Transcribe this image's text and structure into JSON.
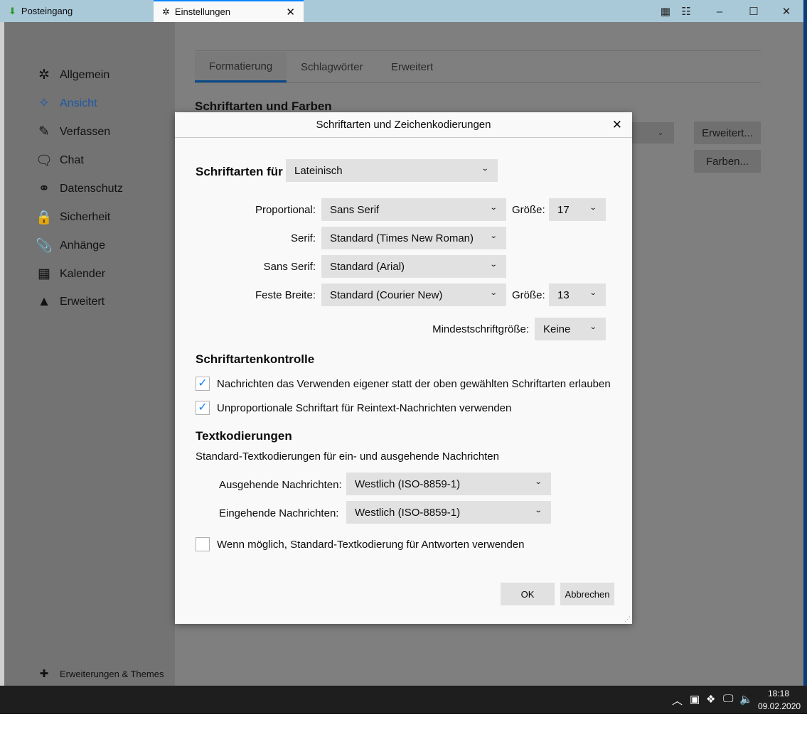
{
  "window": {
    "tabs": [
      {
        "label": "Posteingang",
        "icon": "inbox-download-icon"
      },
      {
        "label": "Einstellungen",
        "icon": "gear-icon"
      }
    ],
    "close_tab": "X"
  },
  "sidebar": {
    "items": [
      {
        "label": "Allgemein",
        "icon": "gear-icon"
      },
      {
        "label": "Ansicht",
        "icon": "sparkle-icon"
      },
      {
        "label": "Verfassen",
        "icon": "pencil-icon"
      },
      {
        "label": "Chat",
        "icon": "chat-bubble-icon"
      },
      {
        "label": "Datenschutz",
        "icon": "mask-icon"
      },
      {
        "label": "Sicherheit",
        "icon": "lock-icon"
      },
      {
        "label": "Anhänge",
        "icon": "paperclip-icon"
      },
      {
        "label": "Kalender",
        "icon": "calendar-icon"
      },
      {
        "label": "Erweitert",
        "icon": "wizard-hat-icon"
      }
    ],
    "selected": "Ansicht",
    "footer": "Erweiterungen & Themes"
  },
  "page": {
    "tabs": [
      "Formatierung",
      "Schlagwörter",
      "Erweitert"
    ],
    "section": "Schriftarten und Farben",
    "buttons": [
      "Erweitert...",
      "Farben..."
    ]
  },
  "dialog": {
    "title": "Schriftarten und Zeichenkodierungen",
    "fonts_for_label": "Schriftarten für",
    "fonts_for_value": "Lateinisch",
    "rows": [
      {
        "label": "Proportional:",
        "value": "Sans Serif"
      },
      {
        "label": "Serif:",
        "value": "Standard (Times New Roman)"
      },
      {
        "label": "Sans Serif:",
        "value": "Standard (Arial)"
      },
      {
        "label": "Feste Breite:",
        "value": "Standard (Courier New)"
      }
    ],
    "size_label": "Größe:",
    "proportional_size": "17",
    "monospace_size": "13",
    "min_size_label": "Mindestschriftgröße:",
    "min_size_value": "Keine",
    "control_heading": "Schriftartenkontrolle",
    "checkboxes": [
      {
        "label": "Nachrichten das Verwenden eigener statt der oben gewählten Schriftarten erlauben",
        "checked": true
      },
      {
        "label": "Unproportionale Schriftart für Reintext-Nachrichten verwenden",
        "checked": true
      }
    ],
    "encoding_heading": "Textkodierungen",
    "encoding_desc": "Standard-Textkodierungen für ein- und ausgehende Nachrichten",
    "outgoing_label": "Ausgehende Nachrichten:",
    "outgoing_value": "Westlich (ISO-8859-1)",
    "incoming_label": "Eingehende Nachrichten:",
    "incoming_value": "Westlich (ISO-8859-1)",
    "reply_checkbox": {
      "label": "Wenn möglich, Standard-Textkodierung für Antworten verwenden",
      "checked": false
    },
    "ok": "OK",
    "cancel": "Abbrechen"
  },
  "taskbar": {
    "time": "18:18",
    "date": "09.02.2020"
  },
  "colors": {
    "accent": "#0a84ff",
    "selected_nav": "#1c5aa6"
  }
}
